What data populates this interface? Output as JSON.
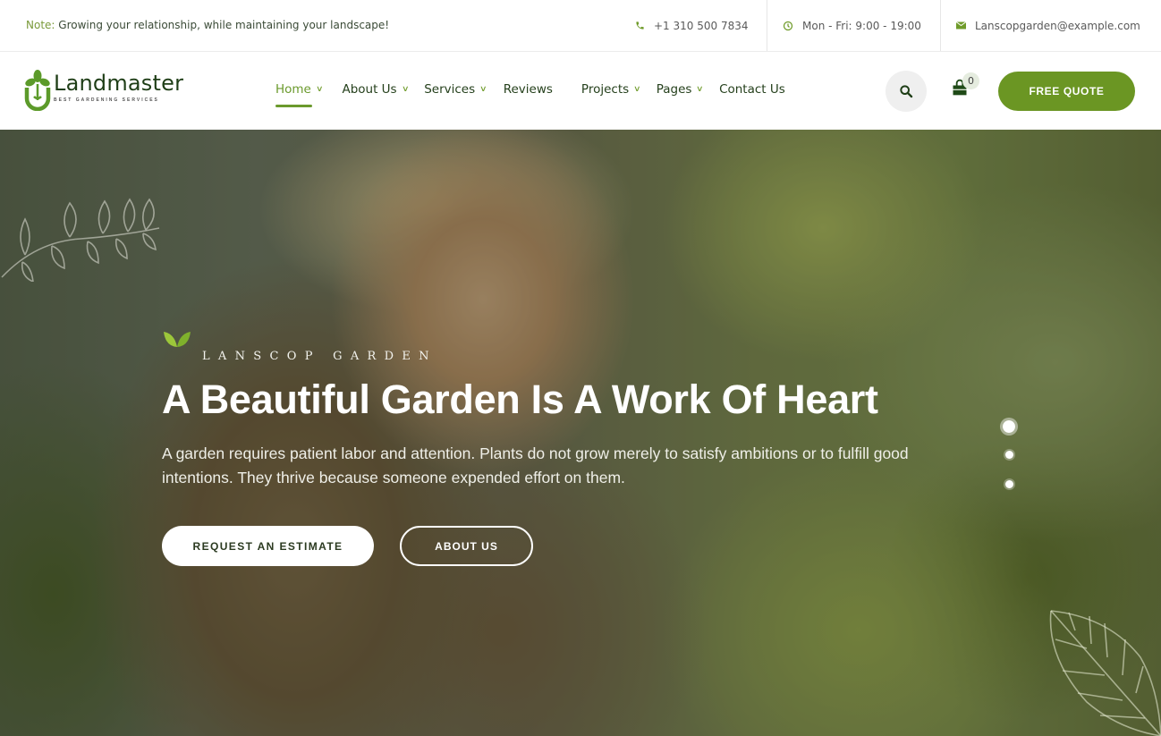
{
  "topbar": {
    "note_label": "Note:",
    "note_text": " Growing your relationship, while maintaining your landscape!",
    "phone": "+1 310 500 7834",
    "hours": "Mon - Fri: 9:00 - 19:00",
    "email": "Lanscopgarden@example.com",
    "icons": {
      "phone": "phone-icon",
      "hours": "clock-icon",
      "email": "envelope-icon"
    }
  },
  "header": {
    "logo": {
      "name": "Landmaster",
      "tagline": "BEST GARDENING SERVICES"
    },
    "nav": [
      {
        "label": "Home",
        "dropdown": true,
        "active": true
      },
      {
        "label": "About Us",
        "dropdown": true,
        "active": false
      },
      {
        "label": "Services",
        "dropdown": true,
        "active": false
      },
      {
        "label": "Reviews",
        "dropdown": false,
        "active": false
      },
      {
        "label": "Projects",
        "dropdown": true,
        "active": false
      },
      {
        "label": "Pages",
        "dropdown": true,
        "active": false
      },
      {
        "label": "Contact Us",
        "dropdown": false,
        "active": false
      }
    ],
    "cart_count": "0",
    "quote_button": "FREE QUOTE"
  },
  "hero": {
    "tagline": "LANSCOP GARDEN",
    "title": "A Beautiful Garden Is A Work Of Heart",
    "description": "A garden requires patient labor and attention. Plants do not grow merely to satisfy ambitions or to fulfill good intentions. They thrive because someone expended effort on them.",
    "primary_button": "REQUEST AN ESTIMATE",
    "secondary_button": "ABOUT US",
    "slider": {
      "total": 3,
      "active": 1
    }
  },
  "colors": {
    "brand_green": "#6b9623",
    "dark_green": "#1f3e17",
    "nav_text": "#25401c"
  }
}
